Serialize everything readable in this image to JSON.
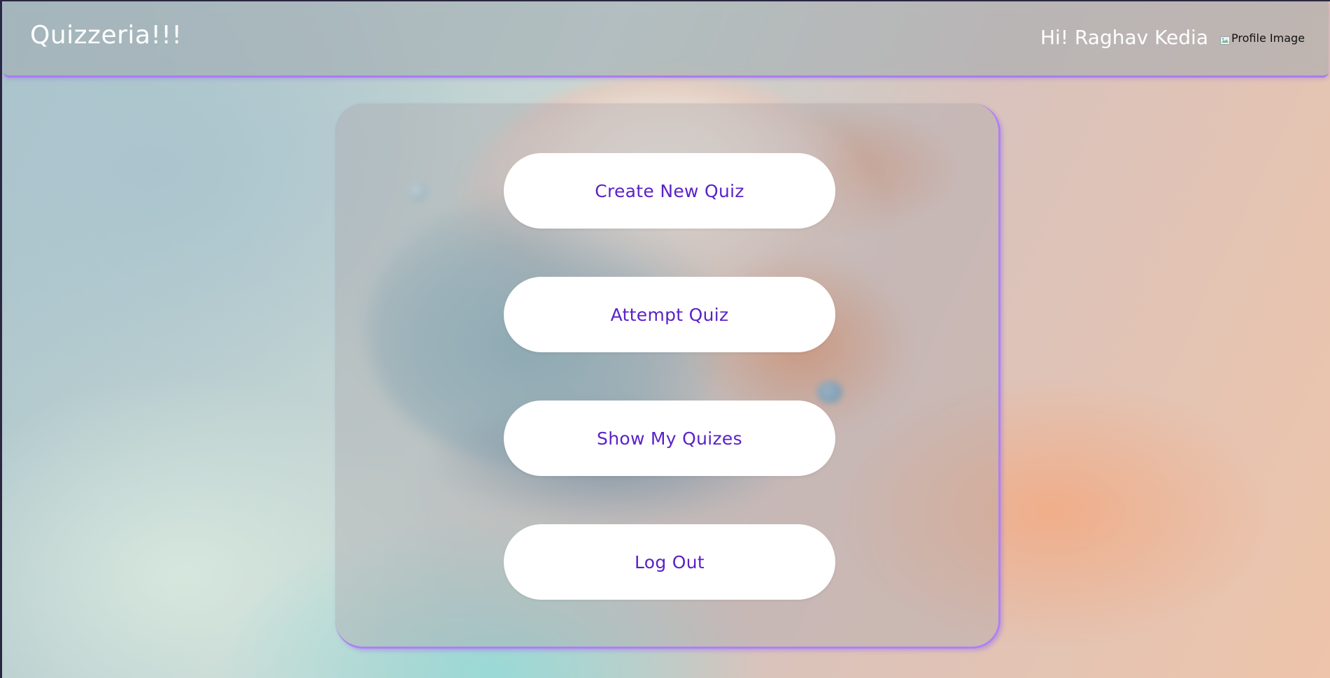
{
  "header": {
    "brand": "Quizzeria!!!",
    "greeting": "Hi! Raghav Kedia",
    "profile_image_alt": "Profile Image",
    "profile_image_icon": "broken-image-icon"
  },
  "menu": {
    "create_quiz_label": "Create New Quiz",
    "attempt_quiz_label": "Attempt Quiz",
    "show_quizzes_label": "Show My Quizes",
    "logout_label": "Log Out"
  },
  "colors": {
    "accent_border": "#a97df0",
    "button_text": "#5a22c8",
    "button_bg": "#ffffff",
    "header_text": "#ffffff"
  }
}
